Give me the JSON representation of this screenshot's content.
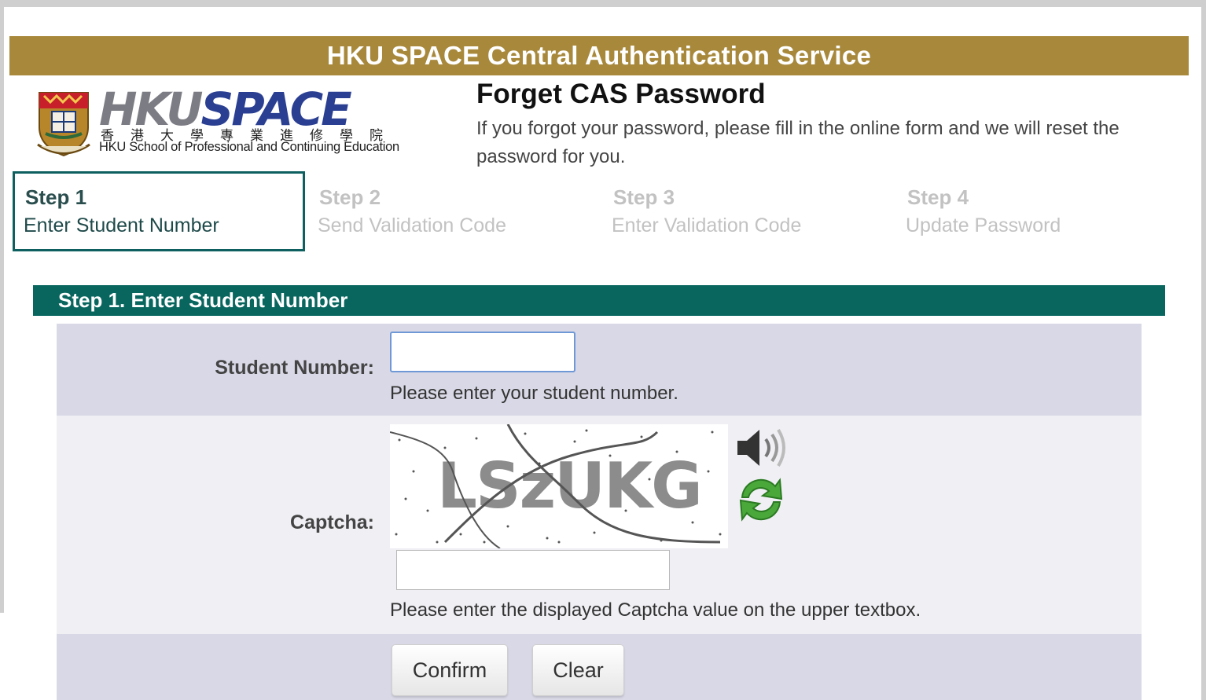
{
  "banner": {
    "title": "HKU SPACE Central Authentication Service"
  },
  "logo": {
    "word_hku": "HKU",
    "word_space": "SPACE",
    "chinese": "香港大學專業進修學院",
    "english": "HKU School of Professional and Continuing Education",
    "crest_icon": "hku-crest-icon"
  },
  "page": {
    "heading": "Forget CAS Password",
    "intro": "If you forgot your password, please fill in the online form and we will reset the password for you."
  },
  "steps": [
    {
      "num": "Step 1",
      "desc": "Enter Student Number",
      "active": true
    },
    {
      "num": "Step 2",
      "desc": "Send Validation Code",
      "active": false
    },
    {
      "num": "Step 3",
      "desc": "Enter Validation Code",
      "active": false
    },
    {
      "num": "Step 4",
      "desc": "Update Password",
      "active": false
    }
  ],
  "section": {
    "title": "Step 1. Enter Student Number"
  },
  "form": {
    "student_label": "Student Number:",
    "student_value": "",
    "student_hint": "Please enter your student number.",
    "captcha_label": "Captcha:",
    "captcha_image_text": "LSzUKG",
    "captcha_value": "",
    "captcha_hint": "Please enter the displayed Captcha value on the upper textbox.",
    "audio_icon": "speaker-icon",
    "refresh_icon": "refresh-icon"
  },
  "buttons": {
    "confirm": "Confirm",
    "clear": "Clear"
  },
  "colors": {
    "banner": "#a8893c",
    "section_bar": "#08665f",
    "active_step_border": "#0e6060",
    "row_dark": "#d8d8e6",
    "row_light": "#efeff4"
  }
}
